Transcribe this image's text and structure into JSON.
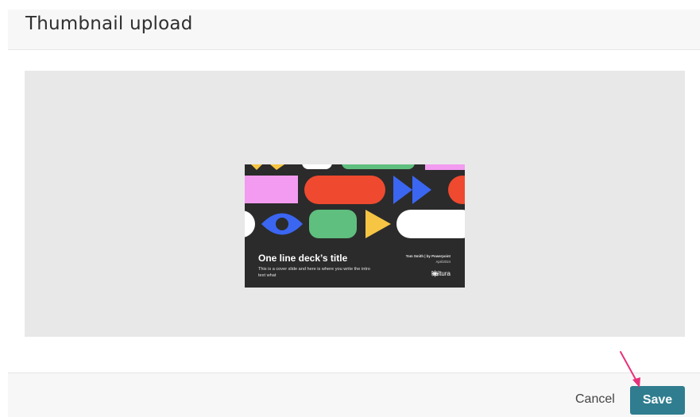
{
  "dialog": {
    "title": "Thumbnail upload"
  },
  "thumbnail": {
    "deck_title": "One line deck’s title",
    "deck_subtitle": "This is a cover slide and here is where you write the intro text what",
    "author": "Tom Smith | by Powerpoint",
    "date": "April2024",
    "logo_text": "kaltura",
    "palette": {
      "background": "#2b2b2b",
      "pink": "#f29bf0",
      "red": "#ef4a2f",
      "blue": "#3a66f2",
      "green": "#5fbf7e",
      "yellow": "#f6c544",
      "white": "#ffffff"
    }
  },
  "footer": {
    "cancel_label": "Cancel",
    "save_label": "Save"
  },
  "colors": {
    "save_button": "#2f7d8f",
    "annotation_arrow": "#e8307a"
  }
}
